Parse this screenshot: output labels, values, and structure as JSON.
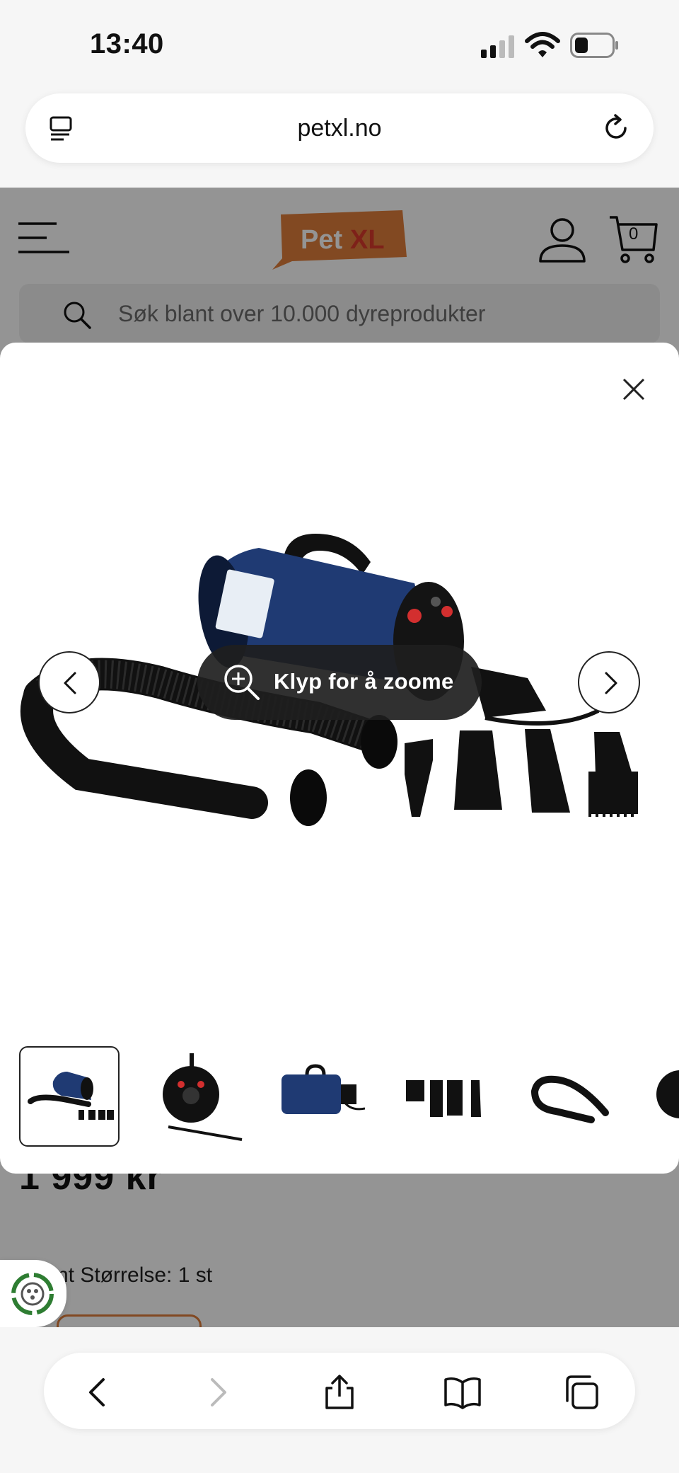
{
  "status_bar": {
    "time": "13:40",
    "icons": [
      "cellular-signal-icon",
      "wifi-icon",
      "battery-icon"
    ]
  },
  "browser": {
    "url": "petxl.no",
    "icons": [
      "reader-view-icon",
      "reload-icon"
    ]
  },
  "site": {
    "logo": "Pet XL",
    "cart_count": "0",
    "search_placeholder": "Søk blant over 10.000 dyreprodukter",
    "price": "1 999 kr",
    "variant_label": "nt Størrelse: 1 st",
    "icons": [
      "menu-icon",
      "user-icon",
      "cart-icon",
      "search-icon",
      "recycle-badge-icon"
    ]
  },
  "modal": {
    "zoom_label": "Klyp for å zoome",
    "thumbnails": [
      {
        "name": "thumb-dryer-set",
        "selected": true
      },
      {
        "name": "thumb-dryer-front",
        "selected": false
      },
      {
        "name": "thumb-dryer-side",
        "selected": false
      },
      {
        "name": "thumb-nozzles",
        "selected": false
      },
      {
        "name": "thumb-hose",
        "selected": false
      },
      {
        "name": "thumb-partial",
        "selected": false
      }
    ],
    "icons": [
      "close-icon",
      "chevron-left-icon",
      "chevron-right-icon",
      "zoom-in-icon"
    ]
  },
  "toolbar": {
    "icons": [
      "back-icon",
      "forward-icon",
      "share-icon",
      "bookmarks-icon",
      "tabs-icon"
    ]
  },
  "colors": {
    "brand_orange": "#e07f3c",
    "logo_xl_red": "#d93a2b",
    "dryer_blue": "#1f3a73",
    "pill_dark": "#1e1e1e"
  }
}
